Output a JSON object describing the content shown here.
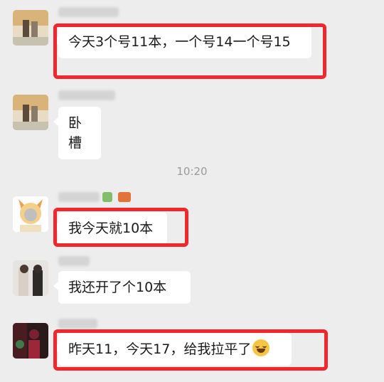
{
  "chat": {
    "timestamp": "10:20",
    "messages": [
      {
        "text": "今天3个号11本，一个号14一个号15",
        "highlighted": true,
        "avatar": "avatar-couple-sunset"
      },
      {
        "text": "卧槽",
        "highlighted": false,
        "avatar": "avatar-couple-sunset"
      },
      {
        "text": "我今天就10本",
        "highlighted": true,
        "avatar": "avatar-cartoon-cat"
      },
      {
        "text": "我还开了个10本",
        "highlighted": false,
        "avatar": "avatar-couple-photo"
      },
      {
        "text": "昨天11，今天17，给我拉平了",
        "emoji": "laughing-tears-emoji",
        "highlighted": true,
        "avatar": "avatar-dark-red"
      }
    ]
  },
  "colors": {
    "background": "#ededed",
    "bubble": "#ffffff",
    "highlight_border": "#f2272d",
    "timestamp": "#9a9a9a"
  }
}
